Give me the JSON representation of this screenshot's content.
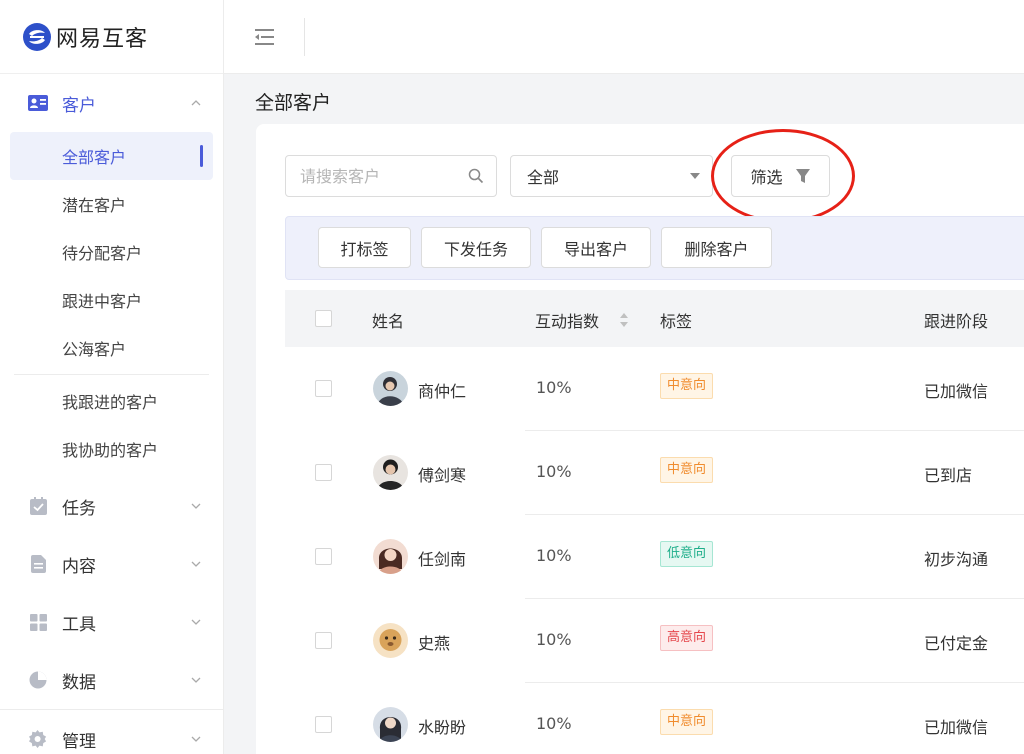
{
  "brand": {
    "name": "网易互客"
  },
  "sidebar": {
    "customer": {
      "label": "客户",
      "items": [
        {
          "label": "全部客户",
          "active": true
        },
        {
          "label": "潜在客户"
        },
        {
          "label": "待分配客户"
        },
        {
          "label": "跟进中客户"
        },
        {
          "label": "公海客户"
        }
      ],
      "items2": [
        {
          "label": "我跟进的客户"
        },
        {
          "label": "我协助的客户"
        }
      ]
    },
    "groups": [
      {
        "label": "任务",
        "icon": "task-icon"
      },
      {
        "label": "内容",
        "icon": "document-icon"
      },
      {
        "label": "工具",
        "icon": "grid-icon"
      },
      {
        "label": "数据",
        "icon": "pie-chart-icon"
      },
      {
        "label": "管理",
        "icon": "gear-icon"
      }
    ]
  },
  "page": {
    "title": "全部客户"
  },
  "search": {
    "placeholder": "请搜索客户",
    "value": ""
  },
  "select": {
    "value": "全部"
  },
  "filter": {
    "label": "筛选"
  },
  "actions": [
    "打标签",
    "下发任务",
    "导出客户",
    "删除客户"
  ],
  "table": {
    "headers": {
      "name": "姓名",
      "score": "互动指数",
      "tag": "标签",
      "stage": "跟进阶段"
    },
    "rows": [
      {
        "name": "商仲仁",
        "score": "10%",
        "tag": "中意向",
        "level": "mid",
        "stage": "已加微信"
      },
      {
        "name": "傅剑寒",
        "score": "10%",
        "tag": "中意向",
        "level": "mid",
        "stage": "已到店"
      },
      {
        "name": "任剑南",
        "score": "10%",
        "tag": "低意向",
        "level": "low",
        "stage": "初步沟通"
      },
      {
        "name": "史燕",
        "score": "10%",
        "tag": "高意向",
        "level": "high",
        "stage": "已付定金"
      },
      {
        "name": "水盼盼",
        "score": "10%",
        "tag": "中意向",
        "level": "mid",
        "stage": "已加微信"
      }
    ]
  },
  "colors": {
    "accent": "#4a5bd9",
    "highlight": "#e62117"
  }
}
